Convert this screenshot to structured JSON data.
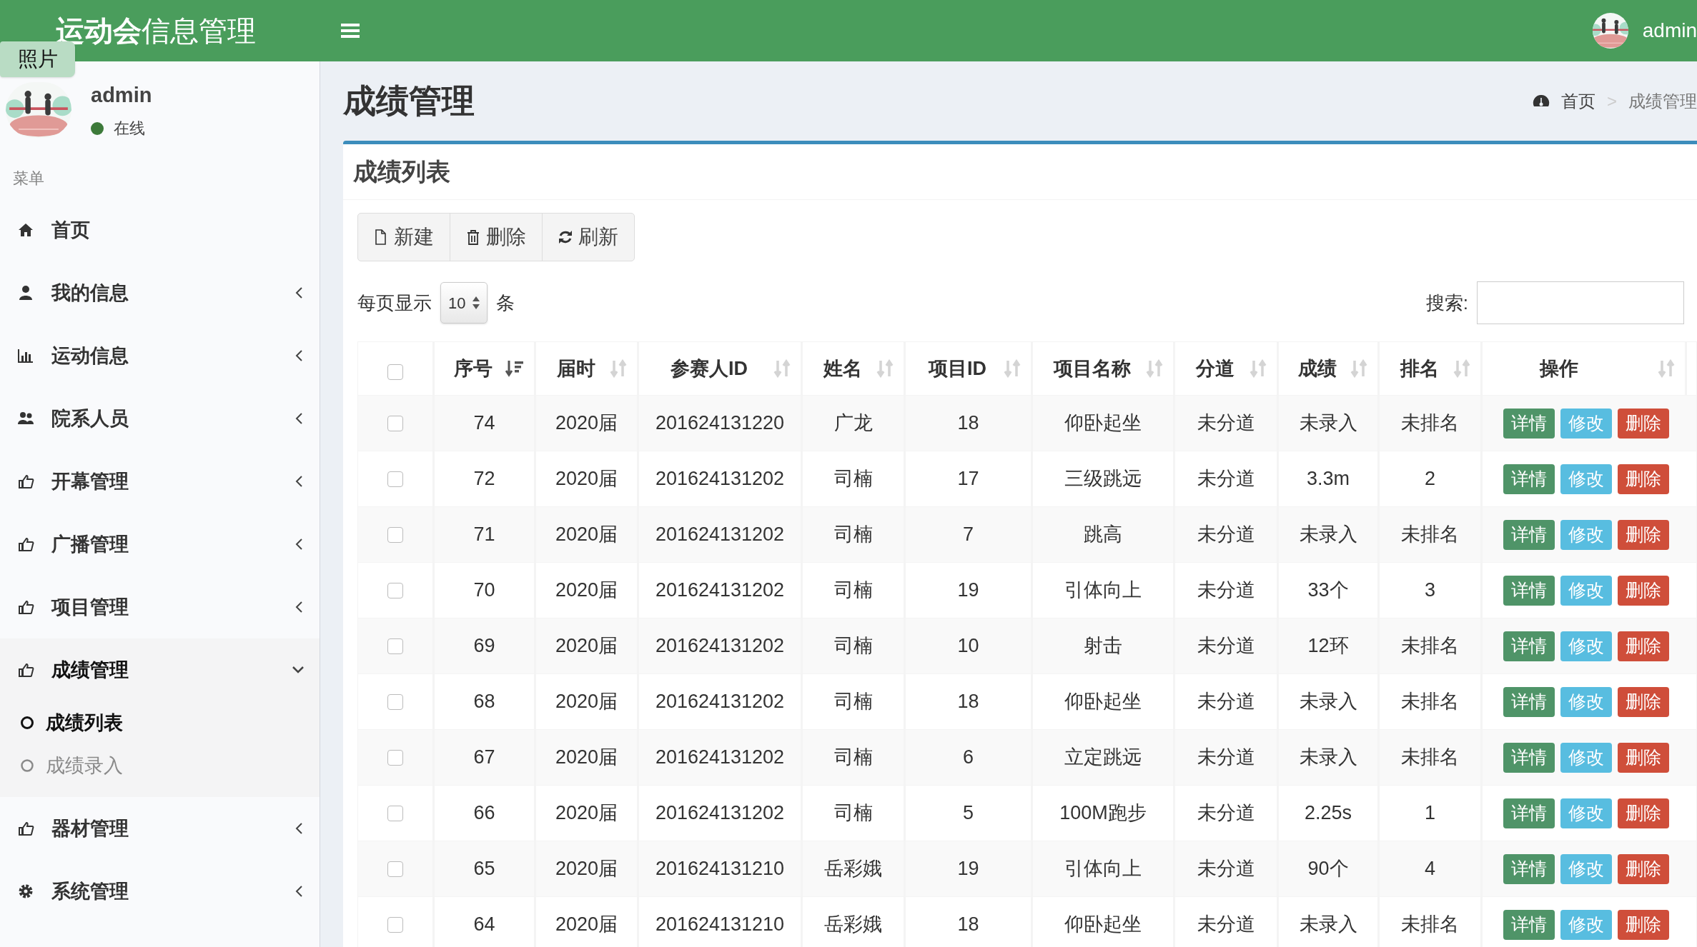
{
  "header": {
    "logo_bold": "运动会",
    "logo_light": "信息管理",
    "user": "admin"
  },
  "photo_tab": "照片",
  "user_panel": {
    "name": "admin",
    "status": "在线",
    "online": true
  },
  "sidebar": {
    "heading": "菜单",
    "items": [
      {
        "label": "首页",
        "kind": "home",
        "has_arrow": false,
        "selected": false
      },
      {
        "label": "我的信息",
        "kind": "user",
        "has_arrow": true,
        "expanded": false,
        "selected": false
      },
      {
        "label": "运动信息",
        "kind": "chart",
        "has_arrow": true,
        "expanded": false,
        "selected": false
      },
      {
        "label": "院系人员",
        "kind": "users",
        "has_arrow": true,
        "expanded": false,
        "selected": false
      },
      {
        "label": "开幕管理",
        "kind": "hand",
        "has_arrow": true,
        "expanded": false,
        "selected": false
      },
      {
        "label": "广播管理",
        "kind": "hand",
        "has_arrow": true,
        "expanded": false,
        "selected": false
      },
      {
        "label": "项目管理",
        "kind": "hand",
        "has_arrow": true,
        "expanded": false,
        "selected": false
      },
      {
        "label": "成绩管理",
        "kind": "hand",
        "has_arrow": true,
        "expanded": true,
        "selected": true,
        "children": [
          {
            "label": "成绩列表",
            "selected": true
          },
          {
            "label": "成绩录入",
            "selected": false
          }
        ]
      },
      {
        "label": "器材管理",
        "kind": "hand",
        "has_arrow": true,
        "expanded": false,
        "selected": false
      },
      {
        "label": "系统管理",
        "kind": "gear",
        "has_arrow": true,
        "expanded": false,
        "selected": false
      }
    ]
  },
  "page_title": "成绩管理",
  "breadcrumb": [
    {
      "kind": "link",
      "label": "首页"
    },
    {
      "kind": "separator",
      "label": ">"
    },
    {
      "kind": "current",
      "label": "成绩管理"
    }
  ],
  "box": {
    "title": "成绩列表",
    "toolbar": [
      {
        "label": "新建",
        "kind": "new"
      },
      {
        "label": "删除",
        "kind": "delete"
      },
      {
        "label": "刷新",
        "kind": "refresh"
      }
    ],
    "length": {
      "prefix": "每页显示",
      "value": "10",
      "suffix": "条"
    },
    "search": {
      "label": "搜索:"
    },
    "table": {
      "header_checked": false,
      "columns": [
        {
          "label": "序号",
          "sorted": true
        },
        {
          "label": "届时",
          "sorted": false
        },
        {
          "label": "参赛人ID",
          "sorted": false
        },
        {
          "label": "姓名",
          "sorted": false
        },
        {
          "label": "项目ID",
          "sorted": false
        },
        {
          "label": "项目名称",
          "sorted": false
        },
        {
          "label": "分道",
          "sorted": false
        },
        {
          "label": "成绩",
          "sorted": false
        },
        {
          "label": "排名",
          "sorted": false
        },
        {
          "label": "操作",
          "sorted": false
        }
      ],
      "rows": [
        {
          "checked": false,
          "cells": [
            "74",
            "2020届",
            "201624131220",
            "广龙",
            "18",
            "仰卧起坐",
            "未分道",
            "未录入",
            "未排名"
          ],
          "actions": [
            "详情",
            "修改",
            "删除"
          ]
        },
        {
          "checked": false,
          "cells": [
            "72",
            "2020届",
            "201624131202",
            "司楠",
            "17",
            "三级跳远",
            "未分道",
            "3.3m",
            "2"
          ],
          "actions": [
            "详情",
            "修改",
            "删除"
          ]
        },
        {
          "checked": false,
          "cells": [
            "71",
            "2020届",
            "201624131202",
            "司楠",
            "7",
            "跳高",
            "未分道",
            "未录入",
            "未排名"
          ],
          "actions": [
            "详情",
            "修改",
            "删除"
          ]
        },
        {
          "checked": false,
          "cells": [
            "70",
            "2020届",
            "201624131202",
            "司楠",
            "19",
            "引体向上",
            "未分道",
            "33个",
            "3"
          ],
          "actions": [
            "详情",
            "修改",
            "删除"
          ]
        },
        {
          "checked": false,
          "cells": [
            "69",
            "2020届",
            "201624131202",
            "司楠",
            "10",
            "射击",
            "未分道",
            "12环",
            "未排名"
          ],
          "actions": [
            "详情",
            "修改",
            "删除"
          ]
        },
        {
          "checked": false,
          "cells": [
            "68",
            "2020届",
            "201624131202",
            "司楠",
            "18",
            "仰卧起坐",
            "未分道",
            "未录入",
            "未排名"
          ],
          "actions": [
            "详情",
            "修改",
            "删除"
          ]
        },
        {
          "checked": false,
          "cells": [
            "67",
            "2020届",
            "201624131202",
            "司楠",
            "6",
            "立定跳远",
            "未分道",
            "未录入",
            "未排名"
          ],
          "actions": [
            "详情",
            "修改",
            "删除"
          ]
        },
        {
          "checked": false,
          "cells": [
            "66",
            "2020届",
            "201624131202",
            "司楠",
            "5",
            "100M跑步",
            "未分道",
            "2.25s",
            "1"
          ],
          "actions": [
            "详情",
            "修改",
            "删除"
          ]
        },
        {
          "checked": false,
          "cells": [
            "65",
            "2020届",
            "201624131210",
            "岳彩娥",
            "19",
            "引体向上",
            "未分道",
            "90个",
            "4"
          ],
          "actions": [
            "详情",
            "修改",
            "删除"
          ]
        },
        {
          "checked": false,
          "cells": [
            "64",
            "2020届",
            "201624131210",
            "岳彩娥",
            "18",
            "仰卧起坐",
            "未分道",
            "未录入",
            "未排名"
          ],
          "actions": [
            "详情",
            "修改",
            "删除"
          ]
        }
      ]
    }
  }
}
